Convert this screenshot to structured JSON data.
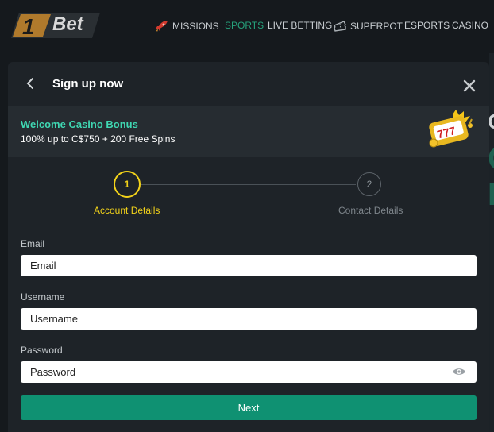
{
  "brand": {
    "logo_numeral": "1",
    "logo_text": "Bet"
  },
  "nav": {
    "items": [
      {
        "label": "MISSIONS",
        "icon": "rocket-icon",
        "active": false
      },
      {
        "label": "SPORTS",
        "icon": "",
        "active": true
      },
      {
        "label": "LIVE BETTING",
        "icon": "",
        "active": false
      },
      {
        "label": "SUPERPOT",
        "icon": "ticket-icon",
        "active": false
      },
      {
        "label": "ESPORTS",
        "icon": "",
        "active": false
      },
      {
        "label": "CASINO",
        "icon": "",
        "active": false
      }
    ]
  },
  "modal": {
    "title": "Sign up now",
    "back_icon": "chevron-left-icon",
    "close_icon": "close-icon"
  },
  "bonus": {
    "title": "Welcome Casino Bonus",
    "subtitle": "100% up to C$750 + 200 Free Spins",
    "icon": "slot-machine-icon"
  },
  "steps": [
    {
      "number": "1",
      "label": "Account Details",
      "active": true
    },
    {
      "number": "2",
      "label": "Contact Details",
      "active": false
    }
  ],
  "form": {
    "email": {
      "label": "Email",
      "placeholder": "Email",
      "value": ""
    },
    "username": {
      "label": "Username",
      "placeholder": "Username",
      "value": ""
    },
    "password": {
      "label": "Password",
      "placeholder": "Password",
      "value": "",
      "icon": "eye-icon"
    },
    "submit_label": "Next"
  },
  "colors": {
    "accent_green": "#0f9172",
    "active_nav": "#26a17b",
    "bonus_title": "#3fd7b2",
    "step_active": "#f2d21a",
    "modal_bg": "#1e2328",
    "page_bg": "#15191d"
  }
}
